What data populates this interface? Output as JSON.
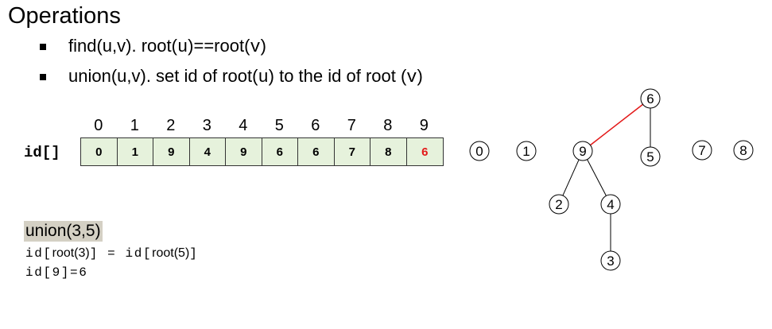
{
  "title": "Operations",
  "bullets": [
    {
      "pre": "find(u,v). root(",
      "mono1": "u",
      "mid": ")==root(",
      "mono2": "v",
      "post": ")"
    },
    {
      "pre": "union(u,v). set id of root(",
      "mono1": "u",
      "mid": ") to the id of root (",
      "mono2": "v",
      "post": ")"
    }
  ],
  "array": {
    "label": "id[]",
    "indices": [
      "0",
      "1",
      "2",
      "3",
      "4",
      "5",
      "6",
      "7",
      "8",
      "9"
    ],
    "values": [
      "0",
      "1",
      "9",
      "4",
      "9",
      "6",
      "6",
      "7",
      "8",
      "6"
    ],
    "highlight_index": 9,
    "cell_color": "#e6f2dc",
    "highlight_color": "#e31919"
  },
  "operation": {
    "title": "union(3,5)",
    "line1_a": "id[",
    "line1_b": "root(3)",
    "line1_c": "] = id[",
    "line1_d": "root(5)",
    "line1_e": "]",
    "line2": "id[9]=6"
  },
  "forest": {
    "nodes": [
      "0",
      "1",
      "9",
      "5",
      "7",
      "8",
      "2",
      "4",
      "3",
      "6"
    ],
    "edges": [
      [
        "6",
        "9"
      ],
      [
        "6",
        "5"
      ],
      [
        "9",
        "2"
      ],
      [
        "9",
        "4"
      ],
      [
        "4",
        "3"
      ]
    ],
    "new_edge": [
      "6",
      "9"
    ],
    "new_edge_color": "#e31919"
  }
}
